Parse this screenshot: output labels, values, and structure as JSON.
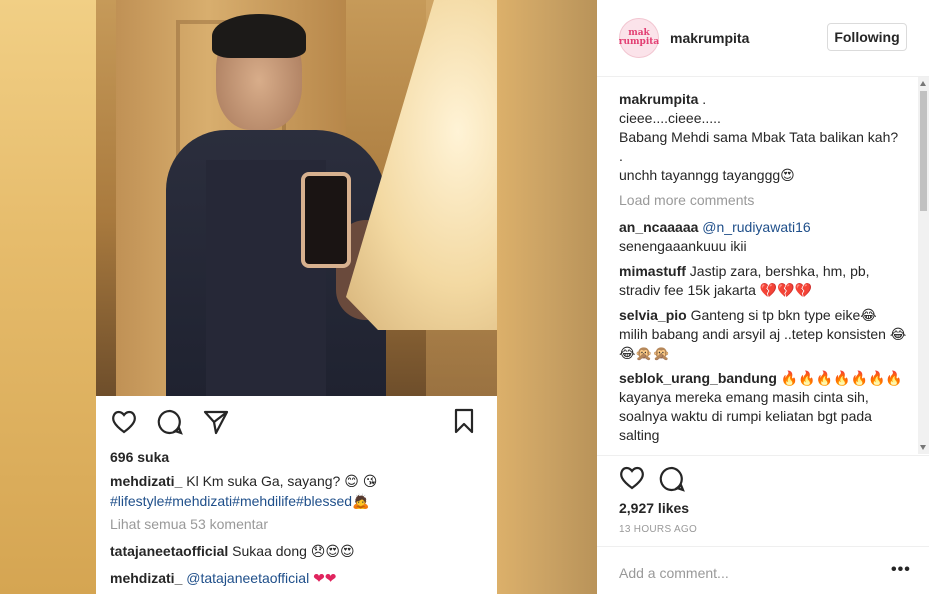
{
  "post": {
    "likes": "696 suka",
    "caption_user": "mehdizati_",
    "caption_text": "Kl Km suka Ga, sayang? 😊 😘",
    "hashtags": "#lifestyle#mehdizati#mehdilife#blessed🙇",
    "view_all": "Lihat semua 53 komentar",
    "comments": [
      {
        "user": "tatajaneetaofficial",
        "text": "Sukaa dong 😞😍😍"
      },
      {
        "user": "mehdizati_",
        "mention": "@tatajaneetaofficial",
        "text": "❤❤"
      }
    ]
  },
  "panel": {
    "username": "makrumpita",
    "avatar_text": "mak rumpita",
    "follow_label": "Following",
    "caption_user": "makrumpita",
    "caption_lines": [
      ".",
      "cieee....cieee.....",
      "Babang Mehdi sama Mbak Tata balikan kah?",
      ".",
      "unchh tayanngg tayanggg😍"
    ],
    "load_more": "Load more comments",
    "comments": [
      {
        "user": "an_ncaaaaa",
        "mention": "@n_rudiyawati16",
        "text": "senengaaankuuu ikii"
      },
      {
        "user": "mimastuff",
        "text": "Jastip zara, bershka, hm, pb, stradiv fee 15k jakarta 💔💔💔"
      },
      {
        "user": "selvia_pio",
        "text": "Ganteng si tp bkn type eike😂 milih babang andi arsyil aj ..tetep konsisten 😂😂🙊🙊"
      },
      {
        "user": "seblok_urang_bandung",
        "text": "🔥🔥🔥🔥🔥🔥🔥 kayanya mereka emang masih cinta sih, soalnya waktu di rumpi keliatan bgt pada salting"
      }
    ],
    "likes": "2,927 likes",
    "time": "13 HOURS AGO",
    "add_comment_placeholder": "Add a comment...",
    "more_label": "•••"
  },
  "icons": [
    "heart-icon",
    "comment-icon",
    "share-icon",
    "bookmark-icon",
    "more-icon"
  ]
}
